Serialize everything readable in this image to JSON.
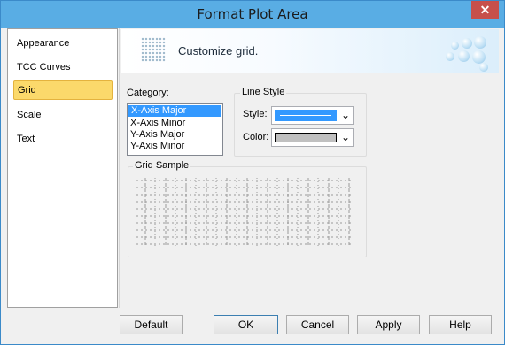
{
  "window": {
    "title": "Format Plot Area",
    "close_glyph": "✕"
  },
  "sidebar": {
    "items": [
      {
        "label": "Appearance",
        "selected": false
      },
      {
        "label": "TCC Curves",
        "selected": false
      },
      {
        "label": "Grid",
        "selected": true
      },
      {
        "label": "Scale",
        "selected": false
      },
      {
        "label": "Text",
        "selected": false
      }
    ]
  },
  "banner": {
    "text": "Customize grid."
  },
  "category": {
    "label": "Category:",
    "items": [
      {
        "label": "X-Axis Major",
        "selected": true
      },
      {
        "label": "X-Axis Minor",
        "selected": false
      },
      {
        "label": "Y-Axis Major",
        "selected": false
      },
      {
        "label": "Y-Axis Minor",
        "selected": false
      }
    ]
  },
  "line_style": {
    "group_title": "Line Style",
    "style_label": "Style:",
    "color_label": "Color:",
    "selected_color": "#c0c0c0",
    "line_color": "#3399ff"
  },
  "grid_sample": {
    "title": "Grid Sample"
  },
  "buttons": {
    "default": "Default",
    "ok": "OK",
    "cancel": "Cancel",
    "apply": "Apply",
    "help": "Help"
  }
}
